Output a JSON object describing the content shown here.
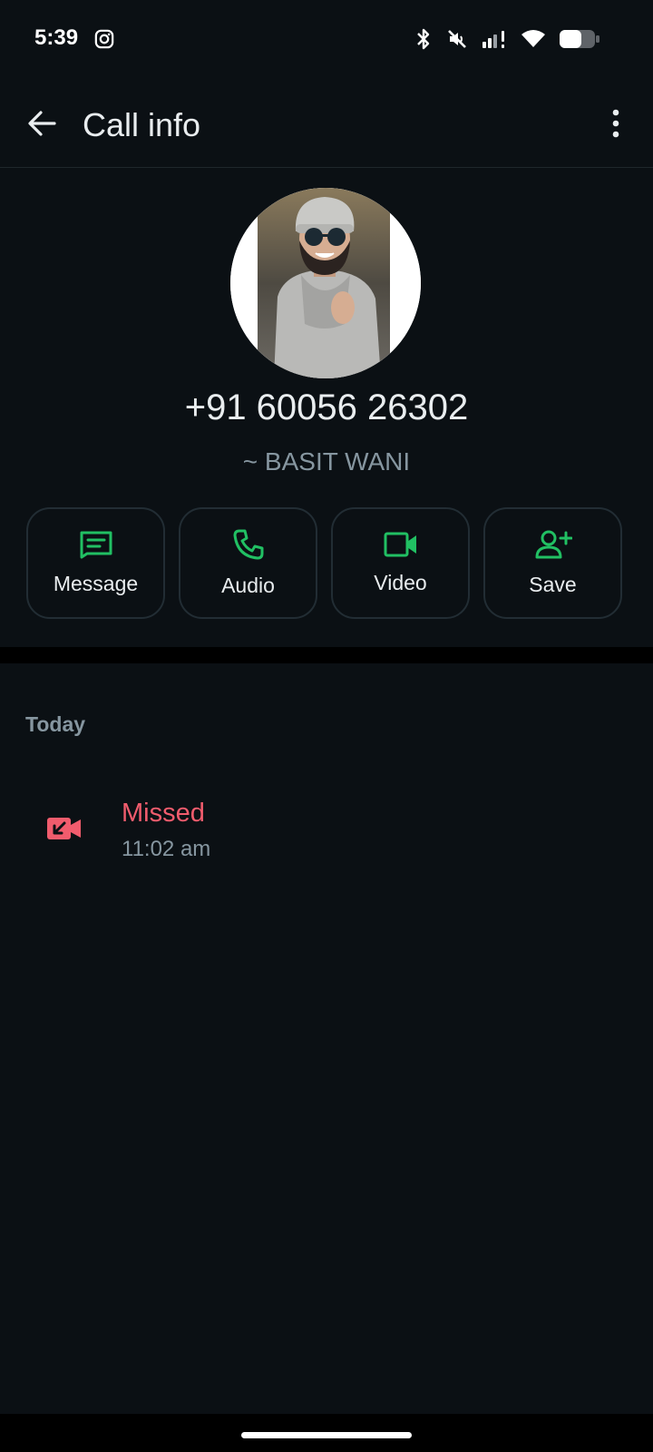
{
  "status_bar": {
    "time": "5:39",
    "icons": [
      "instagram-icon",
      "bluetooth-icon",
      "mute-icon",
      "signal-icon",
      "wifi-icon",
      "battery-icon"
    ]
  },
  "app_bar": {
    "title": "Call info",
    "back_icon": "arrow-left-icon",
    "menu_icon": "more-vertical-icon"
  },
  "contact": {
    "phone": "+91 60056 26302",
    "alias": "~ BASIT WANI"
  },
  "actions": [
    {
      "label": "Message",
      "icon": "message-icon"
    },
    {
      "label": "Audio",
      "icon": "phone-icon"
    },
    {
      "label": "Video",
      "icon": "video-icon"
    },
    {
      "label": "Save",
      "icon": "add-contact-icon"
    }
  ],
  "calls": {
    "section_label": "Today",
    "items": [
      {
        "status": "Missed",
        "time": "11:02 am",
        "icon": "missed-video-call-icon"
      }
    ]
  },
  "colors": {
    "background": "#0b1014",
    "accent_green": "#21c063",
    "missed_red": "#f15c6d",
    "secondary_text": "#8696a0"
  }
}
